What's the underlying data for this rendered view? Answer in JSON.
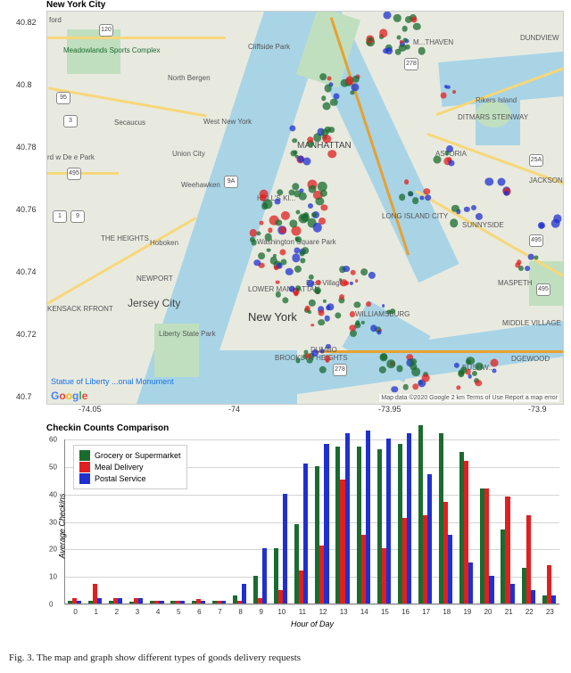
{
  "map": {
    "title": "New York City",
    "y_ticks": [
      "40.82",
      "40.8",
      "40.78",
      "40.76",
      "40.74",
      "40.72",
      "40.7"
    ],
    "x_ticks": [
      "-74.05",
      "-74",
      "-73.95",
      "-73.9"
    ],
    "labels": {
      "manhattan": "MANHATTAN",
      "newyork": "New York",
      "jersey": "Jersey City",
      "hoboken": "Hoboken",
      "secaucus": "Secaucus",
      "unioncity": "Union City",
      "weehawken": "Weehawken",
      "westny": "West New\nYork",
      "cliffside": "Cliffside Park",
      "northbergen": "North Bergen",
      "heights": "THE HEIGHTS",
      "newport": "NEWPORT",
      "liberty": "Liberty\nState Park",
      "wsp": "Washington\nSquare Park",
      "hells": "HELL'S KI...",
      "ev": "East Village",
      "lm": "LOWER\nMANHATTAN",
      "wburg": "WILLIAMSBURG",
      "bklyn": "BROOKLYN\nHEIGHTS",
      "dumbo": "DUMBO",
      "lic": "LONG ISLAND CITY",
      "sunny": "SUNNYSIDE",
      "maspeth": "MASPETH",
      "middle": "MIDDLE VILLAGE",
      "astoria": "ASTORIA",
      "ditmars": "DITMARS\nSTEINWAY",
      "rikers": "Rikers Island",
      "jackson": "JACKSON",
      "bush": "BUSHW...",
      "dgewood": "DGEWOOD",
      "haven": "M...THAVEN",
      "boundview": "DUNDVIEW",
      "ford": "ford",
      "mcomplex": "Meadowlands\nSports Complex",
      "deke": "rd w De\ne Park",
      "kensack": "KENSACK\nRFRONT",
      "statue": "Statue of Liberty\n...onal Monument",
      "google": "Google"
    },
    "highways": [
      "95",
      "3",
      "495",
      "9",
      "1",
      "9A",
      "278",
      "495",
      "278",
      "25A",
      "120",
      "495"
    ],
    "attribution": "Map data ©2020 Google    2 km                  Terms of Use   Report a map error"
  },
  "chart_data": {
    "type": "bar",
    "title": "Checkin Counts Comparison",
    "xlabel": "Hour of Day",
    "ylabel": "Average Checkins",
    "ylim": [
      0,
      60
    ],
    "categories": [
      0,
      1,
      2,
      3,
      4,
      5,
      6,
      7,
      8,
      9,
      10,
      11,
      12,
      13,
      14,
      15,
      16,
      17,
      18,
      19,
      20,
      21,
      22,
      23
    ],
    "series": [
      {
        "name": "Grocery or Supermarket",
        "color": "#1b6b2f",
        "values": [
          1,
          1,
          1,
          0.5,
          1,
          1,
          1,
          1,
          3,
          10,
          20,
          29,
          50,
          57,
          57,
          56,
          58,
          65,
          62,
          55,
          42,
          27,
          13,
          3
        ]
      },
      {
        "name": "Meal Delivery",
        "color": "#e02020",
        "values": [
          2,
          7,
          2,
          2,
          1,
          1,
          1.5,
          1,
          1,
          2,
          5,
          12,
          21,
          45,
          25,
          20,
          31,
          32,
          37,
          52,
          42,
          39,
          32,
          14
        ]
      },
      {
        "name": "Postal Service",
        "color": "#2030d0",
        "values": [
          1,
          2,
          2,
          2,
          1,
          1,
          1,
          1,
          7,
          20,
          40,
          51,
          58,
          62,
          63,
          60,
          62,
          47,
          25,
          15,
          10,
          7,
          5,
          3
        ]
      }
    ]
  },
  "caption": "Fig. 3.   The map and graph show different types of goods delivery requests"
}
